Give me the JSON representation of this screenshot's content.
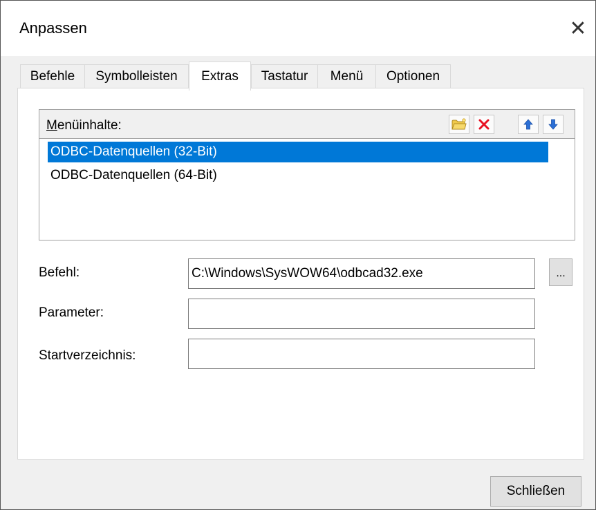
{
  "window": {
    "title": "Anpassen",
    "close_glyph": "✕"
  },
  "tabs": [
    {
      "label": "Befehle"
    },
    {
      "label": "Symbolleisten"
    },
    {
      "label": "Extras"
    },
    {
      "label": "Tastatur"
    },
    {
      "label": "Menü"
    },
    {
      "label": "Optionen"
    }
  ],
  "active_tab": "Extras",
  "menu_contents": {
    "label_underlined": "M",
    "label_rest": "enüinhalte:",
    "toolbar": [
      {
        "name": "new-folder-icon"
      },
      {
        "name": "delete-icon"
      },
      {
        "name": "move-up-icon"
      },
      {
        "name": "move-down-icon"
      }
    ],
    "items": [
      {
        "label": "ODBC-Datenquellen (32-Bit)",
        "selected": true
      },
      {
        "label": "ODBC-Datenquellen (64-Bit)",
        "selected": false
      }
    ]
  },
  "fields": {
    "command": {
      "label": "Befehl:",
      "value": "C:\\Windows\\SysWOW64\\odbcad32.exe"
    },
    "parameter": {
      "label": "Parameter:",
      "value": ""
    },
    "start_dir": {
      "label": "Startverzeichnis:",
      "value": ""
    }
  },
  "browse_button": {
    "label": "..."
  },
  "close_button": {
    "label": "Schließen"
  },
  "colors": {
    "selection": "#0078d7",
    "window_bg": "#f0f0f0",
    "delete_red": "#e81123",
    "arrow_blue": "#2b6fd6"
  }
}
